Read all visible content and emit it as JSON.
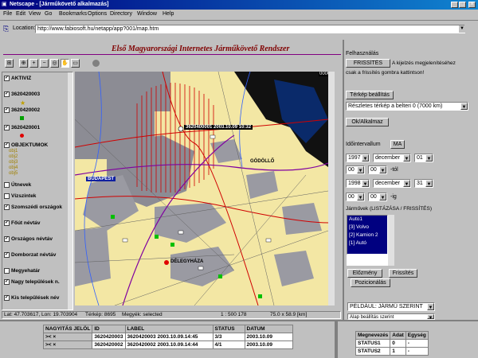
{
  "window": {
    "title": "Netscape - [Járműkövető alkalmazás]"
  },
  "menu": [
    "File",
    "Edit",
    "View",
    "Go",
    "Bookmarks",
    "Options",
    "Directory",
    "Window",
    "Help"
  ],
  "location": {
    "label": "Location:",
    "url": "http://www.fabiosoft.hu/netapp/app?001/map.htm"
  },
  "page": {
    "title": "Első Magyarországi Internetes Járműkövető Rendszer"
  },
  "map": {
    "vehicle_label": "3620400001 2003.10.09 10:32",
    "corner_code": "0006",
    "place_label_1": "GÖDÖLLŐ",
    "place_label_2": "BUDAPEST",
    "place_label_3": "DÉLEGYHÁZA",
    "status": {
      "coords": "Lat: 47.703617, Lon: 19.703904",
      "scale": "Térkép: 8695",
      "selection": "Megyék: selected",
      "zoom": "1 : 500 178",
      "extent": "75.0 x 58.9 [km]"
    }
  },
  "layers": [
    {
      "label": "AKTIVIZ",
      "checked": true
    },
    {
      "label": "3620420003",
      "checked": true
    },
    {
      "label": "3620420002",
      "checked": true
    },
    {
      "label": "3620420001",
      "checked": true
    },
    {
      "label": "OBJEKTUMOK",
      "checked": true
    },
    {
      "label": "Útnevek",
      "checked": false
    },
    {
      "label": "Vízszintek",
      "checked": false
    },
    {
      "label": "Szomszédi országok",
      "checked": true
    },
    {
      "label": "Főút névtáv",
      "checked": true
    },
    {
      "label": "Országos névtáv",
      "checked": true
    },
    {
      "label": "Domborzat névtáv",
      "checked": true
    },
    {
      "label": "Megyehatár",
      "checked": false
    },
    {
      "label": "Nagy települések n.",
      "checked": true
    },
    {
      "label": "Kis települések név",
      "checked": true
    }
  ],
  "sublayers": [
    "obj1",
    "obj2",
    "obj3",
    "obj4",
    "obj5"
  ],
  "right": {
    "fetch_label": "Felhasználás",
    "refresh_btn": "FRISSÍTÉS",
    "refresh_text": "A kijelzés megjelenítéséhez",
    "refresh_text2": "csak a frissítés gombra kattintson!",
    "map_settings_btn": "Térkép beállítás",
    "map_select": "Részletes térkép a belteri 0 (7000 km)",
    "ok_btn": "Ok/Alkalmaz",
    "interval_label": "Időintervallum",
    "interval_btn": "MA",
    "from_year": "1997",
    "from_month": "december",
    "from_day": "01",
    "from_hour": "00",
    "from_min": "00",
    "to_year": "1998",
    "to_month": "december",
    "to_day": "31",
    "to_hour": "00",
    "to_min": "00",
    "hour_unit": "-tól",
    "hour_unit2": "-ig",
    "vehicles_label": "Járművek (LISTÁZÁSA / FRISSÍTÉS)",
    "vehicles": [
      "Auto1",
      "[3] Volvo",
      "[2] Kamion 2",
      "[1] Autó"
    ],
    "history_btn": "Előzmény",
    "refresh2_btn": "Frissítés",
    "position_btn": "Pozicionálás",
    "status_select": "PÉLDÁUL: JÁRMŰ SZERINT",
    "status_select2": "Alap beállítás szerint"
  },
  "bottom": {
    "headers": [
      "NAGYITÁS JELÖL",
      "ID",
      "LABEL",
      "STATUS",
      "DATUM"
    ],
    "rows": [
      [
        "3620420003",
        "3620420003 2003.10.09.14:45",
        "3/3",
        "2003.10.09"
      ],
      [
        "3620420002",
        "3620420002 2003.10.09.14:44",
        "4/1",
        "2003.10.09"
      ]
    ],
    "side_headers": [
      "Megnevezés",
      "Adat",
      "Egység"
    ],
    "side_rows": [
      [
        "STATUS1",
        "0",
        "-"
      ],
      [
        "STATUS2",
        "1",
        "-"
      ]
    ]
  }
}
